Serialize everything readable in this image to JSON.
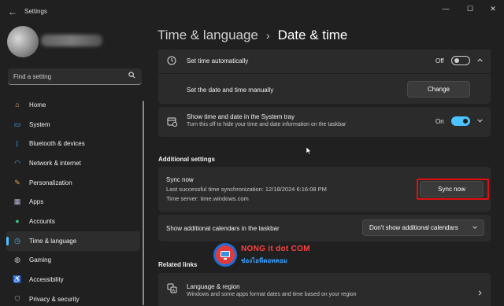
{
  "window": {
    "title": "Settings",
    "controls": {
      "minimize": "—",
      "maximize": "☐",
      "close": "✕"
    }
  },
  "search": {
    "placeholder": "Find a setting"
  },
  "nav": {
    "items": [
      {
        "label": "Home",
        "icon": "home-icon",
        "color": "#e8a87c"
      },
      {
        "label": "System",
        "icon": "monitor-icon",
        "color": "#4cc2ff"
      },
      {
        "label": "Bluetooth & devices",
        "icon": "bluetooth-icon",
        "color": "#2f8fe0"
      },
      {
        "label": "Network & internet",
        "icon": "wifi-icon",
        "color": "#5fb8f0"
      },
      {
        "label": "Personalization",
        "icon": "brush-icon",
        "color": "#e0a050"
      },
      {
        "label": "Apps",
        "icon": "apps-icon",
        "color": "#b8b8d8"
      },
      {
        "label": "Accounts",
        "icon": "person-icon",
        "color": "#3fc080"
      },
      {
        "label": "Time & language",
        "icon": "globe-clock-icon",
        "color": "#4cc2ff",
        "active": true
      },
      {
        "label": "Gaming",
        "icon": "controller-icon",
        "color": "#c8c8c8"
      },
      {
        "label": "Accessibility",
        "icon": "accessibility-icon",
        "color": "#4c9fff"
      },
      {
        "label": "Privacy & security",
        "icon": "shield-icon",
        "color": "#a0a0a0"
      }
    ]
  },
  "breadcrumb": {
    "parent": "Time & language",
    "separator": "›",
    "current": "Date & time"
  },
  "settings": {
    "set_time_auto": {
      "label": "Set time automatically",
      "state": "Off"
    },
    "set_manual": {
      "label": "Set the date and time manually",
      "button": "Change"
    },
    "tray": {
      "label": "Show time and date in the System tray",
      "desc": "Turn this off to hide your time and date information on the taskbar",
      "state": "On"
    }
  },
  "additional": {
    "title": "Additional settings",
    "sync": {
      "label": "Sync now",
      "last_sync": "Last successful time synchronization: 12/18/2024 6:16:08 PM",
      "server": "Time server: time.windows.com",
      "button": "Sync now"
    },
    "calendars": {
      "label": "Show additional calendars in the taskbar",
      "value": "Don't show additional calendars"
    }
  },
  "related": {
    "title": "Related links",
    "language": {
      "label": "Language & region",
      "desc": "Windows and some apps format dates and time based on your region"
    }
  },
  "watermark": {
    "line1": "NONG it dot COM",
    "line2": "ช่องไอทีดอทคอม"
  },
  "colors": {
    "accent": "#4cc2ff",
    "highlight": "#e01010"
  }
}
